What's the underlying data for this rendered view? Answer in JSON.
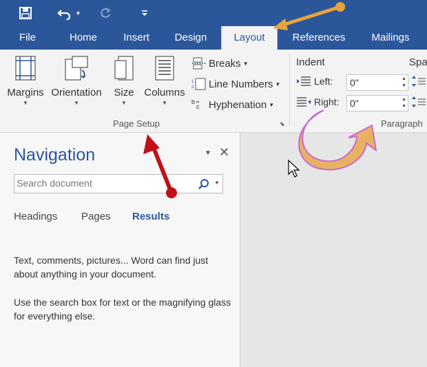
{
  "quick_access": {
    "save_icon": "floppy-disk-icon",
    "undo_icon": "undo-arrow-icon",
    "redo_icon": "redo-icon",
    "customize_icon": "customize-qat-icon"
  },
  "tabs": [
    "File",
    "Home",
    "Insert",
    "Design",
    "Layout",
    "References",
    "Mailings"
  ],
  "active_tab": "Layout",
  "ribbon": {
    "page_setup": {
      "margins": "Margins",
      "orientation": "Orientation",
      "size": "Size",
      "columns": "Columns",
      "breaks": "Breaks",
      "line_numbers": "Line Numbers",
      "hyphenation": "Hyphenation",
      "group_label": "Page Setup"
    },
    "paragraph": {
      "indent_label": "Indent",
      "left_label": "Left:",
      "left_value": "0\"",
      "right_label": "Right:",
      "right_value": "0\"",
      "spacing_label": "Spa",
      "group_label": "Paragraph"
    }
  },
  "navigation": {
    "title": "Navigation",
    "search_placeholder": "Search document",
    "tabs": [
      "Headings",
      "Pages",
      "Results"
    ],
    "active_tab": "Results",
    "message_1": "Text, comments, pictures... Word can find just about anything in your document.",
    "message_2": "Use the search box for text or the magnifying glass for everything else."
  },
  "colors": {
    "title_bar": "#2b579a",
    "ribbon_bg": "#f3f3f3",
    "annotation_orange": "#e8a33d",
    "annotation_red": "#c0101a"
  }
}
